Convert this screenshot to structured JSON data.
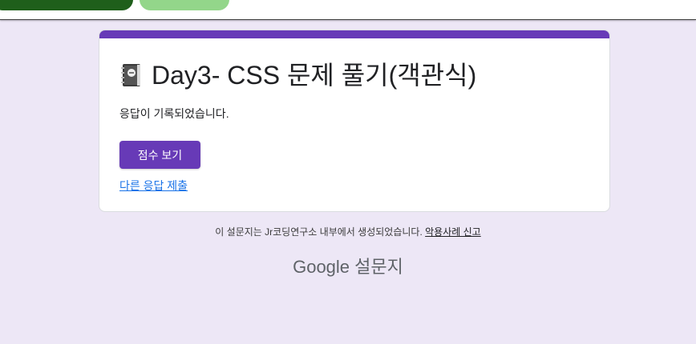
{
  "form": {
    "title": "Day3- CSS 문제 풀기(객관식)",
    "confirmation": "응답이 기록되었습니다.",
    "score_button": "점수 보기",
    "another_response": "다른 응답 제출"
  },
  "footer": {
    "note": "이 설문지는 Jr코딩연구소 내부에서 생성되었습니다.",
    "report_abuse": "악용사례 신고",
    "brand_google": "Google",
    "brand_product": "설문지"
  },
  "colors": {
    "accent": "#673ab7",
    "page_bg": "#ede7f6",
    "link": "#1a73e8"
  },
  "icons": {
    "title_icon": "notebook-icon"
  }
}
